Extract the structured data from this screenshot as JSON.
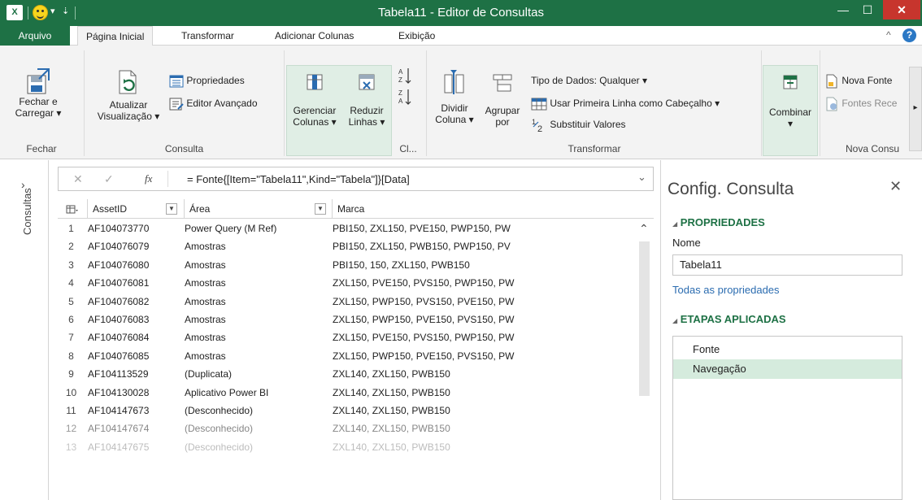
{
  "window": {
    "title": "Tabela11 - Editor de Consultas",
    "app_icon": "X",
    "min_icon": "—",
    "max_icon": "☐",
    "close_icon": "✕",
    "qa_arrow": "▾",
    "qa_more": "⇣"
  },
  "tabs": [
    {
      "label": "Arquivo"
    },
    {
      "label": "Página Inicial"
    },
    {
      "label": "Transformar"
    },
    {
      "label": "Adicionar Colunas"
    },
    {
      "label": "Exibição"
    }
  ],
  "ribbon_controls": {
    "collapse": "^",
    "help": "?"
  },
  "ribbon": {
    "fechar": {
      "btn_line1": "Fechar e",
      "btn_line2": "Carregar ▾",
      "group": "Fechar"
    },
    "consulta": {
      "refresh_line1": "Atualizar",
      "refresh_line2": "Visualização ▾",
      "properties": "Propriedades",
      "advanced_editor": "Editor Avançado",
      "group": "Consulta"
    },
    "cl": {
      "manage_line1": "Gerenciar",
      "manage_line2": "Colunas ▾",
      "reduce_line1": "Reduzir",
      "reduce_line2": "Linhas ▾",
      "group": "Cl..."
    },
    "transformar": {
      "split_line1": "Dividir",
      "split_line2": "Coluna ▾",
      "group_line1": "Agrupar",
      "group_line2": "por",
      "data_type": "Tipo de Dados: Qualquer ▾",
      "first_row_header": "Usar Primeira Linha como Cabeçalho ▾",
      "replace_values": "Substituir Valores",
      "group": "Transformar"
    },
    "combinar": {
      "line1": "Combinar",
      "line2": "▾"
    },
    "nova_consulta": {
      "new_source": "Nova Fonte",
      "recent_sources": "Fontes Rece",
      "group": "Nova Consu"
    }
  },
  "left_pane": {
    "label": "Consultas",
    "expand": "›"
  },
  "formula_bar": {
    "cancel": "✕",
    "accept": "✓",
    "fx": "fx",
    "formula": "= Fonte{[Item=\"Tabela11\",Kind=\"Tabela\"]}[Data]",
    "expand": "⌄"
  },
  "grid": {
    "columns": [
      "AssetID",
      "Área",
      "Marca"
    ],
    "rows": [
      {
        "idx": "1",
        "asset": "AF104073770",
        "area": "Power Query (M Ref)",
        "marca": "PBI150, ZXL150, PVE150, PWP150, PW"
      },
      {
        "idx": "2",
        "asset": "AF104076079",
        "area": "Amostras",
        "marca": "PBI150, ZXL150, PWB150, PWP150, PV"
      },
      {
        "idx": "3",
        "asset": "AF104076080",
        "area": "Amostras",
        "marca": "PBI150, 150, ZXL150, PWB150"
      },
      {
        "idx": "4",
        "asset": "AF104076081",
        "area": "Amostras",
        "marca": "ZXL150, PVE150, PVS150, PWP150, PW"
      },
      {
        "idx": "5",
        "asset": "AF104076082",
        "area": "Amostras",
        "marca": "ZXL150, PWP150, PVS150, PVE150, PW"
      },
      {
        "idx": "6",
        "asset": "AF104076083",
        "area": "Amostras",
        "marca": "ZXL150, PWP150, PVE150, PVS150, PW"
      },
      {
        "idx": "7",
        "asset": "AF104076084",
        "area": "Amostras",
        "marca": "ZXL150, PVE150, PVS150, PWP150, PW"
      },
      {
        "idx": "8",
        "asset": "AF104076085",
        "area": "Amostras",
        "marca": "ZXL150, PWP150, PVE150, PVS150, PW"
      },
      {
        "idx": "9",
        "asset": "AF104113529",
        "area": "(Duplicata)",
        "marca": "ZXL140, ZXL150, PWB150"
      },
      {
        "idx": "10",
        "asset": "AF104130028",
        "area": "Aplicativo Power BI",
        "marca": "ZXL140, ZXL150, PWB150"
      },
      {
        "idx": "11",
        "asset": "AF104147673",
        "area": "(Desconhecido)",
        "marca": "ZXL140, ZXL150, PWB150"
      },
      {
        "idx": "12",
        "asset": "AF104147674",
        "area": "(Desconhecido)",
        "marca": "ZXL140, ZXL150, PWB150"
      },
      {
        "idx": "13",
        "asset": "AF104147675",
        "area": "(Desconhecido)",
        "marca": "ZXL140, ZXL150, PWB150"
      }
    ]
  },
  "right_pane": {
    "title": "Config. Consulta",
    "close": "✕",
    "properties_header": "PROPRIEDADES",
    "name_label": "Nome",
    "name_value": "Tabela11",
    "all_properties": "Todas as propriedades",
    "steps_header": "ETAPAS APLICADAS",
    "section_arrow": "◢",
    "steps": [
      {
        "label": "Fonte"
      },
      {
        "label": "Navegação"
      }
    ]
  },
  "colors": {
    "excel_green": "#1e7145",
    "close_red": "#c7352d",
    "highlight": "#e0eee5",
    "step_active": "#d5ebdd"
  }
}
